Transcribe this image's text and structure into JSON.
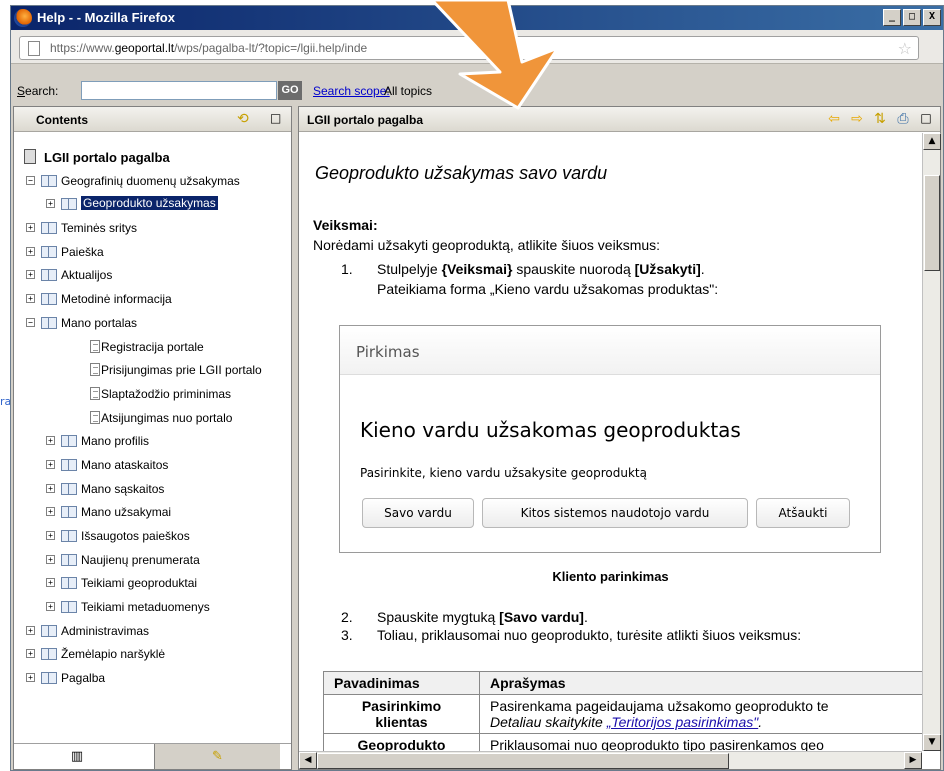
{
  "window": {
    "title": "Help - - Mozilla Firefox",
    "minimize": "_",
    "maximize": "□",
    "close": "X"
  },
  "background": {
    "link_text": "ra"
  },
  "urlbar": {
    "prefix": "https://www.",
    "host": "geoportal.lt",
    "path": "/wps/pagalba-lt/?topic=/lgii.help/inde"
  },
  "search": {
    "label_underlined": "S",
    "label_rest": "earch:",
    "value": "",
    "go": "GO",
    "scope_link": "Search scope:",
    "scope_value": "All topics"
  },
  "contents_pane": {
    "title": "Contents",
    "tree": [
      {
        "label": "LGII portalo pagalba",
        "level": 0,
        "kind": "root"
      },
      {
        "label": "Geografinių duomenų užsakymas",
        "level": 0,
        "kind": "book",
        "expander": "−"
      },
      {
        "label": "Geoprodukto užsakymas",
        "level": 1,
        "kind": "book",
        "expander": "+",
        "selected": true
      },
      {
        "label": "Teminės sritys",
        "level": 0,
        "kind": "book",
        "expander": "+"
      },
      {
        "label": "Paieška",
        "level": 0,
        "kind": "book",
        "expander": "+"
      },
      {
        "label": "Aktualijos",
        "level": 0,
        "kind": "book",
        "expander": "+"
      },
      {
        "label": "Metodinė informacija",
        "level": 0,
        "kind": "book",
        "expander": "+"
      },
      {
        "label": "Mano portalas",
        "level": 0,
        "kind": "book",
        "expander": "−"
      },
      {
        "label": "Registracija portale",
        "level": 2,
        "kind": "page"
      },
      {
        "label": "Prisijungimas prie LGII portalo",
        "level": 2,
        "kind": "page"
      },
      {
        "label": "Slaptažodžio priminimas",
        "level": 2,
        "kind": "page"
      },
      {
        "label": "Atsijungimas nuo portalo",
        "level": 2,
        "kind": "page"
      },
      {
        "label": "Mano profilis",
        "level": 1,
        "kind": "book",
        "expander": "+"
      },
      {
        "label": "Mano ataskaitos",
        "level": 1,
        "kind": "book",
        "expander": "+"
      },
      {
        "label": "Mano sąskaitos",
        "level": 1,
        "kind": "book",
        "expander": "+"
      },
      {
        "label": "Mano užsakymai",
        "level": 1,
        "kind": "book",
        "expander": "+"
      },
      {
        "label": "Išsaugotos paieškos",
        "level": 1,
        "kind": "book",
        "expander": "+"
      },
      {
        "label": "Naujienų prenumerata",
        "level": 1,
        "kind": "book",
        "expander": "+"
      },
      {
        "label": "Teikiami geoproduktai",
        "level": 1,
        "kind": "book",
        "expander": "+"
      },
      {
        "label": "Teikiami metaduomenys",
        "level": 1,
        "kind": "book",
        "expander": "+"
      },
      {
        "label": "Administravimas",
        "level": 0,
        "kind": "book",
        "expander": "+"
      },
      {
        "label": "Žemėlapio naršyklė",
        "level": 0,
        "kind": "book",
        "expander": "+"
      },
      {
        "label": "Pagalba",
        "level": 0,
        "kind": "book",
        "expander": "+"
      }
    ]
  },
  "content_pane": {
    "title": "LGII portalo pagalba",
    "doc_title": "Geoprodukto užsakymas savo vardu",
    "steps_heading": "Veiksmai:",
    "intro": "Norėdami užsakyti geoproduktą, atlikite šiuos veiksmus:",
    "steps": [
      {
        "num": "1.",
        "text": "Stulpelyje {Veiksmai} spauskite nuorodą [Užsakyti].",
        "sub": "Pateikiama forma „Kieno vardu užsakomas produktas\":"
      },
      {
        "num": "2.",
        "text": "Spauskite mygtuką [Savo vardu]."
      },
      {
        "num": "3.",
        "text": "Toliau, priklausomai nuo geoprodukto, turėsite atlikti šiuos veiksmus:"
      }
    ],
    "dialog": {
      "header": "Pirkimas",
      "heading": "Kieno vardu užsakomas geoproduktas",
      "subtext": "Pasirinkite, kieno vardu užsakysite geoproduktą",
      "buttons": [
        "Savo vardu",
        "Kitos sistemos naudotojo vardu",
        "Atšaukti"
      ]
    },
    "caption": "Kliento parinkimas",
    "table": {
      "headers": [
        "Pavadinimas",
        "Aprašymas"
      ],
      "rows": [
        {
          "name": "Pasirinkimo klientas",
          "desc1": "Pasirenkama pageidaujama užsakomo geoprodukto te",
          "desc2_prefix": "Detaliau skaitykite ",
          "desc2_link": "„Teritorijos pasirinkimas\"",
          "desc2_suffix": "."
        },
        {
          "name": "Geoprodukto",
          "desc1": "Priklausomai nuo geoprodukto tipo pasirenkamos geo"
        }
      ]
    }
  },
  "footer_tabs": {
    "contents_tab_icon": "book-icon",
    "bookmarks_tab_icon": "pin-icon"
  },
  "colors": {
    "title_bar": "#0a246a",
    "selection": "#0a246a",
    "arrow": "#f0953a",
    "link": "#0000cc"
  }
}
